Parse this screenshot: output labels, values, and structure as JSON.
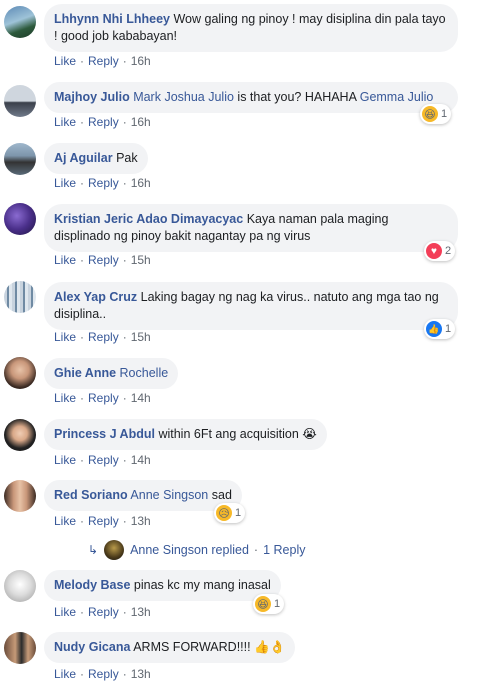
{
  "comments": [
    {
      "author": "Lhhynn Nhi Lhheey",
      "text": "Wow galing ng pinoy ! may disiplina din pala tayo ! good job kababayan!",
      "like": "Like",
      "reply": "Reply",
      "time": "16h"
    },
    {
      "author": "Majhoy Julio",
      "mention1": "Mark Joshua Julio",
      "text": "is that you? HAHAHA",
      "mention2": "Gemma Julio",
      "like": "Like",
      "reply": "Reply",
      "time": "16h",
      "reaction": {
        "type": "haha",
        "count": "1"
      }
    },
    {
      "author": "Aj Aguilar",
      "text": "Pak",
      "like": "Like",
      "reply": "Reply",
      "time": "16h"
    },
    {
      "author": "Kristian Jeric Adao Dimayacyac",
      "text": "Kaya naman pala maging displinado ng pinoy bakit nagantay pa ng virus",
      "like": "Like",
      "reply": "Reply",
      "time": "15h",
      "reaction": {
        "type": "love",
        "count": "2"
      }
    },
    {
      "author": "Alex Yap Cruz",
      "text": "Laking bagay ng nag ka virus.. natuto ang mga tao ng disiplina..",
      "like": "Like",
      "reply": "Reply",
      "time": "15h",
      "reaction": {
        "type": "like",
        "count": "1"
      }
    },
    {
      "author": "Ghie Anne",
      "mention1": "Rochelle",
      "like": "Like",
      "reply": "Reply",
      "time": "14h"
    },
    {
      "author": "Princess J Abdul",
      "text": "within 6Ft ang acquisition",
      "emoji": "😭",
      "like": "Like",
      "reply": "Reply",
      "time": "14h"
    },
    {
      "author": "Red Soriano",
      "mention1": "Anne Singson",
      "text": "sad",
      "like": "Like",
      "reply": "Reply",
      "time": "13h",
      "reaction": {
        "type": "sad",
        "count": "1"
      }
    },
    {
      "author": "Melody Base",
      "text": "pinas kc my mang inasal",
      "like": "Like",
      "reply": "Reply",
      "time": "13h",
      "reaction": {
        "type": "haha",
        "count": "1"
      }
    },
    {
      "author": "Nudy Gicana",
      "text": "ARMS FORWARD!!!!",
      "emoji": "👍👌",
      "like": "Like",
      "reply": "Reply",
      "time": "13h"
    }
  ],
  "reply_summary": {
    "name": "Anne Singson",
    "replied": "replied",
    "dot": "·",
    "count": "1 Reply"
  },
  "separator": "·",
  "colors": {
    "link": "#385898",
    "bubble": "#f2f3f5",
    "meta": "#606770"
  }
}
